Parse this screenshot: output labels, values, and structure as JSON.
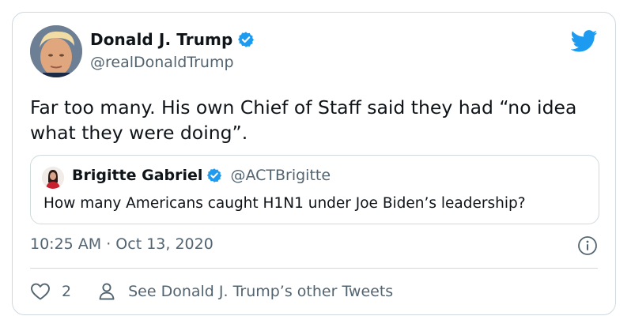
{
  "author": {
    "display_name": "Donald J. Trump",
    "handle": "@realDonaldTrump",
    "verified_icon": "verified-badge-icon"
  },
  "tweet": {
    "text": "Far too many. His own Chief of Staff said they had “no idea what they were doing”.",
    "timestamp": "10:25 AM · Oct 13, 2020"
  },
  "quoted_tweet": {
    "display_name": "Brigitte Gabriel",
    "handle": "@ACTBrigitte",
    "text": "How many Americans caught H1N1 under Joe Biden’s leadership?"
  },
  "actions": {
    "like_count": "2",
    "see_other_label": "See Donald J. Trump’s other Tweets"
  },
  "colors": {
    "brand_blue": "#1d9bf0",
    "secondary_text": "#536471",
    "border": "#cfd9de"
  }
}
